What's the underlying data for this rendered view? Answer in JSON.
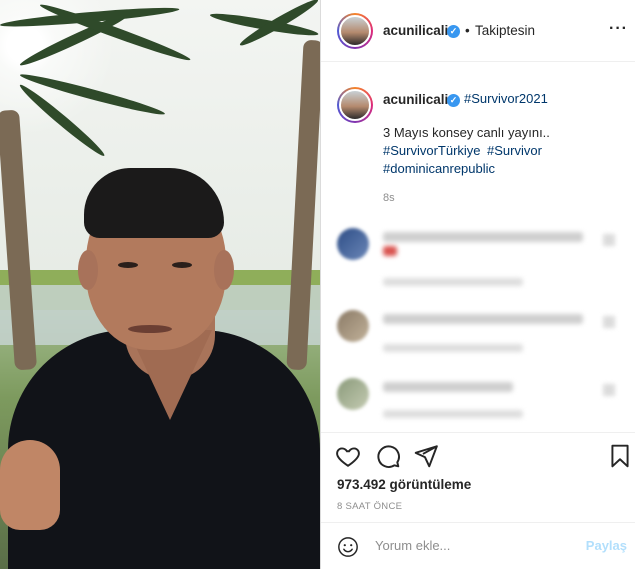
{
  "post": {
    "username": "acunilicali",
    "separator": "•",
    "follow_status": "Takiptesin",
    "more_icon": "ellipsis-icon"
  },
  "caption": {
    "username": "acunilicali",
    "first_hashtag": "#Survivor2021",
    "line1": "3 Mayıs konsey canlı yayını..",
    "line2_tag1": "#SurvivorTürkiye",
    "line2_tag2": "#Survivor",
    "line3_tag": "#dominicanrepublic",
    "time": "8s"
  },
  "actions": {
    "like_icon": "heart-icon",
    "comment_icon": "comment-icon",
    "share_icon": "paper-plane-icon",
    "save_icon": "bookmark-icon",
    "views": "973.492 görüntüleme",
    "posted_ago": "8 SAAT ÖNCE"
  },
  "comment_bar": {
    "emoji_icon": "smiley-icon",
    "placeholder": "Yorum ekle...",
    "share_label": "Paylaş"
  },
  "colors": {
    "link": "#00376b",
    "verified": "#3897f0",
    "share_disabled": "#b2dffc"
  }
}
